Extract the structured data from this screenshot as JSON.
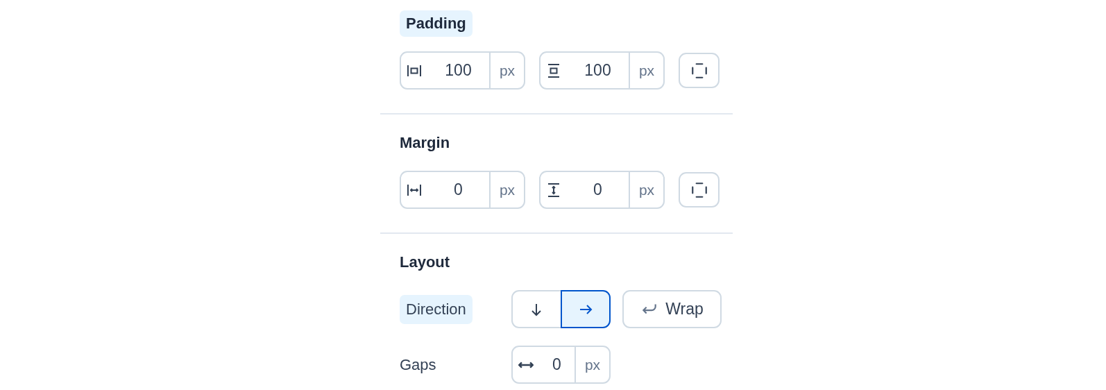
{
  "sections": [
    {
      "title": "Padding",
      "highlighted": true,
      "fields": [
        {
          "kind": "padding-x",
          "value": "100",
          "unit": "px"
        },
        {
          "kind": "padding-y",
          "value": "100",
          "unit": "px"
        }
      ]
    },
    {
      "title": "Margin",
      "highlighted": false,
      "fields": [
        {
          "kind": "margin-x",
          "value": "0",
          "unit": "px"
        },
        {
          "kind": "margin-y",
          "value": "0",
          "unit": "px"
        }
      ]
    },
    {
      "title": "Layout",
      "highlighted": false,
      "rows": [
        {
          "kind": "direction",
          "label": "Direction",
          "highlighted": true,
          "options": [
            {
              "kind": "down",
              "selected": false
            },
            {
              "kind": "right",
              "selected": true
            }
          ],
          "wrap": {
            "label": "Wrap",
            "selected": false
          }
        },
        {
          "kind": "gap",
          "label": "Gaps",
          "highlighted": false,
          "value": "0",
          "unit": "px"
        }
      ]
    }
  ]
}
